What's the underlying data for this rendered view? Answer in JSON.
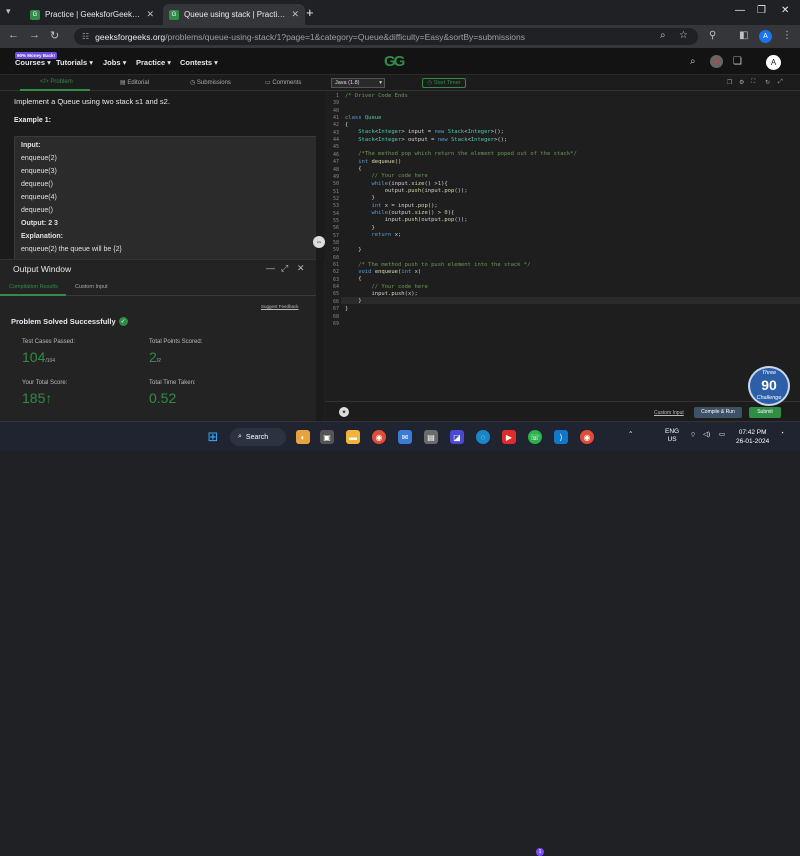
{
  "browser": {
    "tabs": [
      {
        "title": "Practice | GeeksforGeeks | A co"
      },
      {
        "title": "Queue using stack | Practice | G"
      }
    ],
    "url_domain": "geeksforgeeks.org",
    "url_path": "/problems/queue-using-stack/1?page=1&category=Queue&difficulty=Easy&sortBy=submissions",
    "profile_initial": "A"
  },
  "gfg_header": {
    "badge": "90% Money Back!",
    "nav": [
      "Courses",
      "Tutorials",
      "Jobs",
      "Practice",
      "Contests"
    ],
    "logo": "GG",
    "avatar_initial": "A"
  },
  "problem_tabs": [
    "Problem",
    "Editorial",
    "Submissions",
    "Comments"
  ],
  "problem": {
    "statement": "Implement a Queue using two stack s1 and s2.",
    "example_title": "Example 1:",
    "example_lines": [
      "Input:",
      "enqueue(2)",
      "enqueue(3)",
      "dequeue()",
      "enqueue(4)",
      "dequeue()",
      "Output:  2  3",
      "Explanation:",
      "enqueue(2)  the  queue  will  be  {2}"
    ]
  },
  "output_window": {
    "title": "Output Window",
    "tabs": [
      "Compilation Results",
      "Custom Input"
    ],
    "suggest": "Suggest Feedback",
    "status": "Problem Solved Successfully",
    "stats": [
      {
        "label": "Test Cases Passed:",
        "value": "104",
        "sub": "/104"
      },
      {
        "label": "Total Points Scored:",
        "value": "2",
        "sub": "/2"
      },
      {
        "label": "Your Total Score:",
        "value": "185",
        "sub": "↑"
      },
      {
        "label": "Total Time Taken:",
        "value": "0.52",
        "sub": ""
      }
    ]
  },
  "editor": {
    "language": "Java (1.8)",
    "start_timer": "Start Timer",
    "line_numbers": [
      "1",
      "39",
      "40",
      "41",
      "42",
      "43",
      "44",
      "45",
      "46",
      "47",
      "48",
      "49",
      "50",
      "51",
      "52",
      "53",
      "54",
      "55",
      "56",
      "57",
      "58",
      "59",
      "60",
      "61",
      "62",
      "63",
      "64",
      "65",
      "66",
      "67",
      "68",
      "69"
    ],
    "code": [
      "/* Driver Code Ends",
      "",
      "",
      "class Queue",
      "{",
      "    Stack<Integer> input = new Stack<Integer>();",
      "    Stack<Integer> output = new Stack<Integer>();",
      "",
      "    /*The method pop which return the element poped out of the stack*/",
      "    int dequeue()",
      "    {",
      "        // Your code here",
      "        while(input.size() >1){",
      "            output.push(input.pop());",
      "        }",
      "        int x = input.pop();",
      "        while(output.size() > 0){",
      "            input.push(output.pop());",
      "        }",
      "        return x;",
      "",
      "    }",
      "",
      "    /* The method push to push element into the stack */",
      "    void enqueue(int x)",
      "    {",
      "        // Your code here",
      "        input.push(x);",
      "    }",
      "}",
      "",
      ""
    ],
    "custom_input": "Custom Input",
    "compile_run": "Compile & Run",
    "submit": "Submit"
  },
  "challenge": {
    "top": "Three",
    "number": "90",
    "bottom": "Challenge"
  },
  "taskbar": {
    "search": "Search",
    "lang_1": "ENG",
    "lang_2": "US",
    "time": "07:42 PM",
    "date": "26-01-2024",
    "notification_count": "1"
  }
}
